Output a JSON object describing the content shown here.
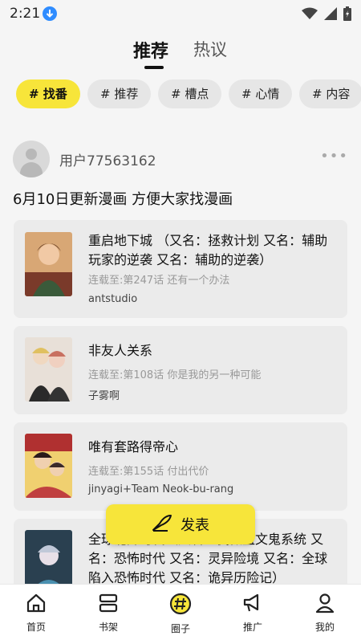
{
  "status_bar": {
    "time": "2:21"
  },
  "header": {
    "tabs": [
      {
        "label": "推荐",
        "active": true
      },
      {
        "label": "热议",
        "active": false
      }
    ]
  },
  "chips": [
    {
      "label": "# 找番",
      "active": true
    },
    {
      "label": "# 推荐",
      "active": false
    },
    {
      "label": "# 槽点",
      "active": false
    },
    {
      "label": "# 心情",
      "active": false
    },
    {
      "label": "# 内容",
      "active": false
    }
  ],
  "post": {
    "username": "用户77563162",
    "title": "6月10日更新漫画 方便大家找漫画",
    "comics": [
      {
        "title": "重启地下城 （又名：拯救计划 又名：辅助玩家的逆袭 又名：辅助的逆袭）",
        "status": "连载至:第247话 还有一个办法",
        "author": "antstudio"
      },
      {
        "title": "非友人关系",
        "status": "连载至:第108话 你是我的另一种可能",
        "author": "子雾啊"
      },
      {
        "title": "唯有套路得帝心",
        "status": "连载至:第155话 付出代价",
        "author": "jinyagi+Team Neok-bu-rang"
      },
      {
        "title": "全球诡异时代（又名：我做盘文鬼系统 又名：恐怖时代 又名：灵异险境 又名：全球陷入恐怖时代 又名：诡异历险记）",
        "status": "",
        "author": ""
      }
    ]
  },
  "fab": {
    "label": "发表"
  },
  "bottom_nav": [
    {
      "label": "首页",
      "icon": "home-icon"
    },
    {
      "label": "书架",
      "icon": "bookshelf-icon"
    },
    {
      "label": "圈子",
      "icon": "circle-hash-icon"
    },
    {
      "label": "推广",
      "icon": "megaphone-icon"
    },
    {
      "label": "我的",
      "icon": "person-icon"
    }
  ],
  "colors": {
    "accent": "#f7e53a",
    "background": "#f5f5f5",
    "card": "#ebebeb"
  }
}
